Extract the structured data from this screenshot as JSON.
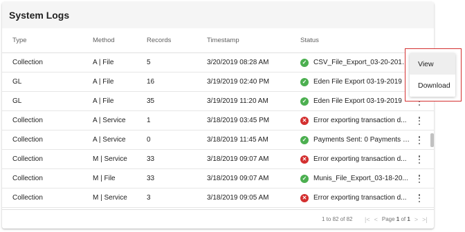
{
  "panel": {
    "title": "System Logs"
  },
  "columns": {
    "type": "Type",
    "method": "Method",
    "records": "Records",
    "timestamp": "Timestamp",
    "status": "Status"
  },
  "rows": [
    {
      "type": "Collection",
      "method": "A | File",
      "records": "5",
      "timestamp": "3/20/2019 08:28 AM",
      "status": "CSV_File_Export_03-20-2019...",
      "status_kind": "success"
    },
    {
      "type": "GL",
      "method": "A | File",
      "records": "16",
      "timestamp": "3/19/2019 02:40 PM",
      "status": "Eden File Export 03-19-2019",
      "status_kind": "success"
    },
    {
      "type": "GL",
      "method": "A | File",
      "records": "35",
      "timestamp": "3/19/2019 11:20 AM",
      "status": "Eden File Export 03-19-2019",
      "status_kind": "success"
    },
    {
      "type": "Collection",
      "method": "A | Service",
      "records": "1",
      "timestamp": "3/18/2019 03:45 PM",
      "status": "Error exporting transaction d...",
      "status_kind": "error"
    },
    {
      "type": "Collection",
      "method": "A | Service",
      "records": "0",
      "timestamp": "3/18/2019 11:45 AM",
      "status": "Payments Sent: 0 Payments I...",
      "status_kind": "success"
    },
    {
      "type": "Collection",
      "method": "M | Service",
      "records": "33",
      "timestamp": "3/18/2019 09:07 AM",
      "status": "Error exporting transaction d...",
      "status_kind": "error"
    },
    {
      "type": "Collection",
      "method": "M | File",
      "records": "33",
      "timestamp": "3/18/2019 09:07 AM",
      "status": "Munis_File_Export_03-18-20...",
      "status_kind": "success"
    },
    {
      "type": "Collection",
      "method": "M | Service",
      "records": "3",
      "timestamp": "3/18/2019 09:05 AM",
      "status": "Error exporting transaction d...",
      "status_kind": "error"
    }
  ],
  "pagination": {
    "range": "1 to 82 of 82",
    "page_word": "Page",
    "page": "1",
    "of_word": "of",
    "total": "1"
  },
  "menu": {
    "items": [
      "View",
      "Download"
    ]
  },
  "icons": {
    "first": "|<",
    "prev": "<",
    "next": ">",
    "last": ">|",
    "ok": "✓",
    "err": "✕"
  },
  "colors": {
    "success": "#4caf50",
    "error": "#d32f2f",
    "highlight": "#d32f2f"
  }
}
